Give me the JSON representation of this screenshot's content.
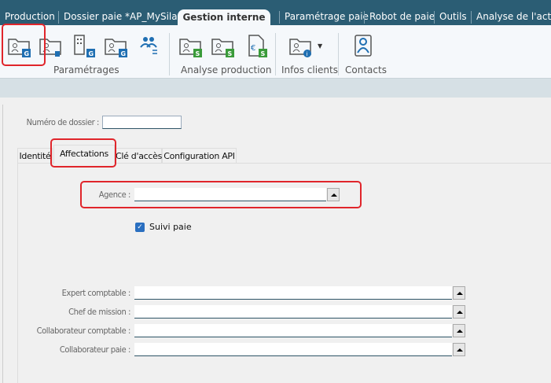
{
  "menu_tabs": [
    {
      "label": "Production"
    },
    {
      "label": "Dossier paie *AP_MySila"
    },
    {
      "label": "Gestion interne",
      "active": true
    },
    {
      "label": "Paramétrage paie"
    },
    {
      "label": "Robot de paie"
    },
    {
      "label": "Outils"
    },
    {
      "label": "Analyse de l'activit"
    }
  ],
  "ribbon": {
    "groups": [
      {
        "label": "Paramétrages",
        "icons": [
          "folder-person-g-icon",
          "folder-person-delete-icon",
          "building-g-icon",
          "folder-lock-g-icon",
          "users-swap-icon"
        ],
        "badges": [
          "G",
          "",
          "G",
          "G",
          ""
        ]
      },
      {
        "label": "Analyse production",
        "icons": [
          "folder-list-s-icon",
          "folder-search-s-icon",
          "document-euro-s-icon"
        ],
        "badges": [
          "S",
          "S",
          "S"
        ]
      },
      {
        "label": "Infos clients",
        "icons": [
          "folder-person-info-icon"
        ]
      },
      {
        "label": "Contacts",
        "icons": [
          "contact-book-icon"
        ]
      }
    ]
  },
  "colors": {
    "topbar": "#2b5d74",
    "highlight": "#e0252b",
    "badge_g": "#1f6fb2",
    "badge_s": "#3a9b3a",
    "checkbox": "#2a6fc0"
  },
  "form": {
    "dossier_label": "Numéro de dossier :",
    "dossier_value": "",
    "tabs": [
      {
        "label": "Identité"
      },
      {
        "label": "Affectations",
        "active": true
      },
      {
        "label": "Clé d'accès"
      },
      {
        "label": "Configuration API"
      }
    ],
    "agence_label": "Agence :",
    "agence_value": "",
    "suivi_label": "Suivi paie",
    "suivi_checked": true,
    "fields": [
      {
        "label": "Expert comptable :",
        "value": ""
      },
      {
        "label": "Chef de mission :",
        "value": ""
      },
      {
        "label": "Collaborateur comptable :",
        "value": ""
      },
      {
        "label": "Collaborateur paie :",
        "value": ""
      }
    ]
  }
}
